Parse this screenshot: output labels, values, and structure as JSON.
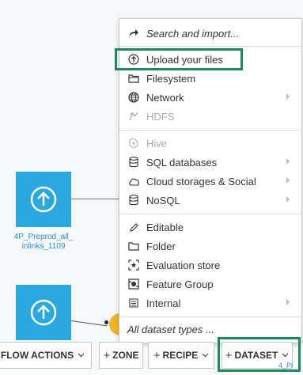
{
  "flow": {
    "node1_label_line1": "4P_Preprod_all_",
    "node1_label_line2": "inlinks_1109",
    "partial_label": "4_Pl"
  },
  "menu": {
    "items": [
      {
        "label": "Search and import...",
        "icon": "share-arrow-icon"
      },
      {
        "label": "Upload your files",
        "icon": "upload-circle-icon"
      },
      {
        "label": "Filesystem",
        "icon": "folder-icon"
      },
      {
        "label": "Network",
        "icon": "globe-icon"
      },
      {
        "label": "HDFS",
        "icon": "hdfs-icon"
      },
      {
        "label": "Hive",
        "icon": "hive-icon"
      },
      {
        "label": "SQL databases",
        "icon": "database-icon"
      },
      {
        "label": "Cloud storages & Social",
        "icon": "cloud-icon"
      },
      {
        "label": "NoSQL",
        "icon": "nosql-database-icon"
      },
      {
        "label": "Editable",
        "icon": "pencil-icon"
      },
      {
        "label": "Folder",
        "icon": "folder-outline-icon"
      },
      {
        "label": "Evaluation store",
        "icon": "evaluation-store-icon"
      },
      {
        "label": "Feature Group",
        "icon": "feature-group-icon"
      },
      {
        "label": "Internal",
        "icon": "internal-icon"
      },
      {
        "label": "All dataset types ...",
        "icon": ""
      }
    ]
  },
  "toolbar": {
    "flow_actions": "FLOW ACTIONS",
    "zone": "ZONE",
    "recipe": "RECIPE",
    "dataset": "DATASET",
    "plus": "+"
  },
  "colors": {
    "node": "#2aa8e0",
    "highlight": "#1e8a5c",
    "recipe": "#f0b429"
  }
}
